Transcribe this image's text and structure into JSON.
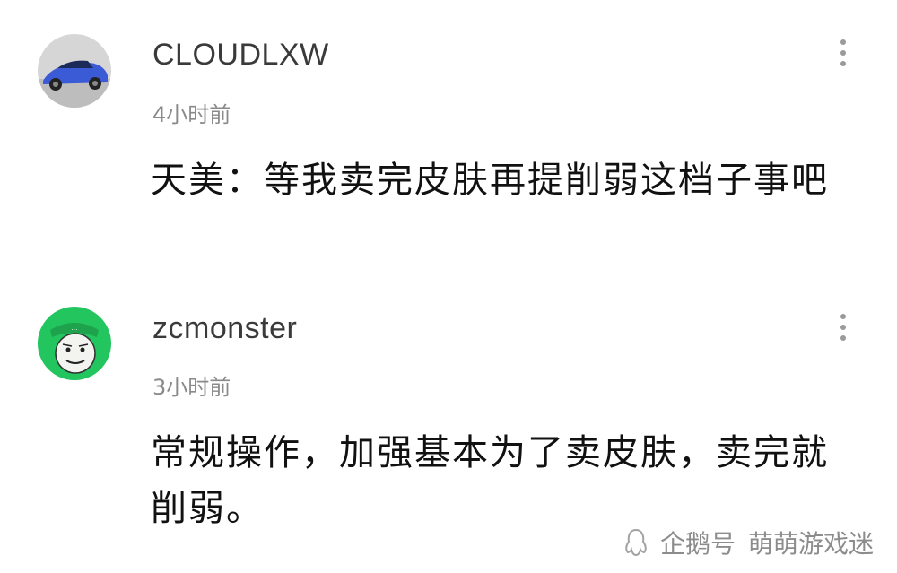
{
  "comments": [
    {
      "username": "CLOUDLXW",
      "time": "4小时前",
      "text": "天美：等我卖完皮肤再提削弱这档子事吧",
      "avatar_icon": "car-avatar-icon"
    },
    {
      "username": "zcmonster",
      "time": "3小时前",
      "text": "常规操作，加强基本为了卖皮肤，卖完就削弱。",
      "avatar_icon": "meme-face-avatar-icon"
    }
  ],
  "watermark": {
    "platform": "企鹅号",
    "account": "萌萌游戏迷"
  },
  "colors": {
    "username": "#3a3a3a",
    "time": "#8a8a8a",
    "text": "#111111",
    "avatar2_bg": "#22c55e",
    "avatar1_bg": "#d9d9d9"
  }
}
